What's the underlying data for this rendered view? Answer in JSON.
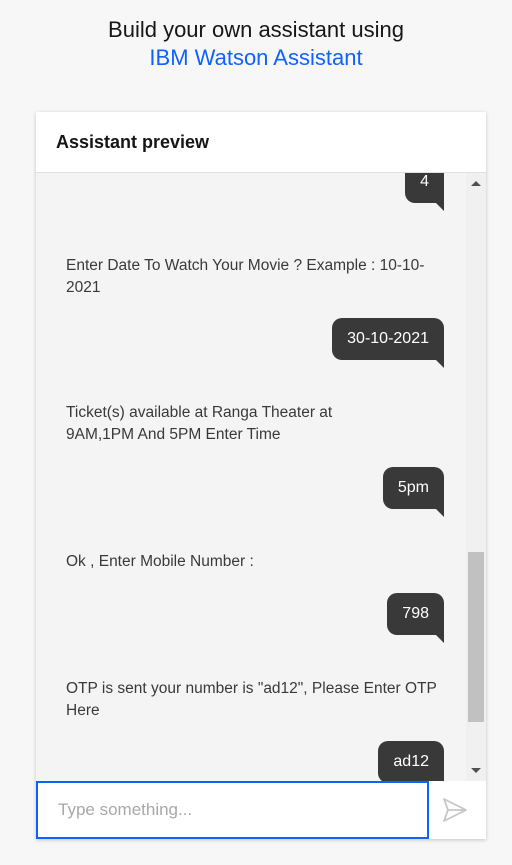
{
  "heading": {
    "line1": "Build your own assistant using",
    "link": "IBM Watson Assistant"
  },
  "panel": {
    "title": "Assistant preview"
  },
  "messages": [
    {
      "from": "user",
      "text": "4"
    },
    {
      "from": "bot",
      "text": "Enter Date To Watch Your Movie ? Example : 10-10-2021"
    },
    {
      "from": "user",
      "text": "30-10-2021"
    },
    {
      "from": "bot",
      "text": "Ticket(s) available at Ranga Theater at 9AM,1PM And 5PM Enter Time"
    },
    {
      "from": "user",
      "text": "5pm"
    },
    {
      "from": "bot",
      "text": "Ok , Enter Mobile Number :"
    },
    {
      "from": "user",
      "text": "798"
    },
    {
      "from": "bot",
      "text": "OTP is sent your number is \"ad12\", Please Enter OTP Here"
    },
    {
      "from": "user",
      "text": "ad12"
    }
  ],
  "input": {
    "placeholder": "Type something...",
    "value": ""
  },
  "icons": {
    "send": "send-icon"
  },
  "colors": {
    "accent": "#0f62fe",
    "user_bubble": "#393939"
  }
}
